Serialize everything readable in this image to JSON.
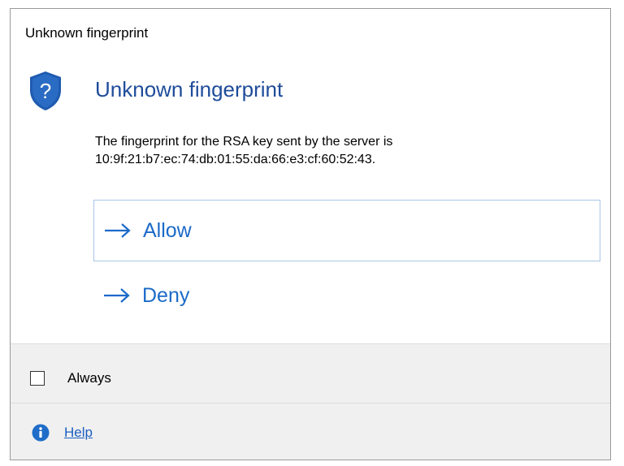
{
  "window": {
    "title": "Unknown fingerprint"
  },
  "main": {
    "heading": "Unknown fingerprint",
    "message_line1": "The fingerprint for the RSA key sent by the server is",
    "message_line2": "10:9f:21:b7:ec:74:db:01:55:da:66:e3:cf:60:52:43."
  },
  "commands": [
    {
      "label": "Allow",
      "focused": true
    },
    {
      "label": "Deny",
      "focused": false
    }
  ],
  "footer": {
    "verification_label": "Always",
    "verification_checked": false,
    "help_label": "Help"
  },
  "icons": {
    "main": "shield-question-icon",
    "command": "arrow-right-icon",
    "help": "info-icon"
  },
  "colors": {
    "heading": "#1e4c9a",
    "link": "#1b6ac9",
    "shield": "#1f5bb0",
    "info": "#1f6dc8",
    "footer_bg": "#f0f0f0"
  }
}
